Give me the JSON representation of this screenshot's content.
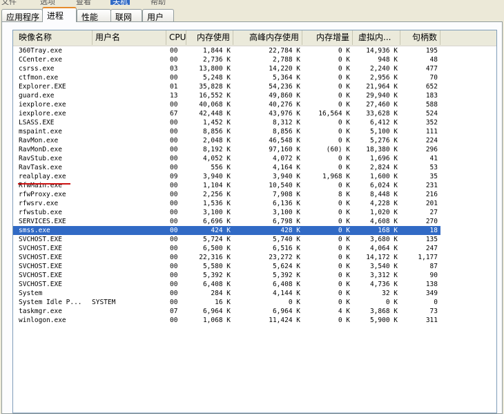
{
  "menubar": {
    "items": [
      "文件",
      "选项",
      "查看",
      "关机",
      "帮助"
    ],
    "active_index": 3
  },
  "tabs": [
    "应用程序",
    "进程",
    "性能",
    "联网",
    "用户"
  ],
  "selected_tab_index": 1,
  "columns": [
    "映像名称",
    "用户名",
    "CPU",
    "内存使用",
    "高峰内存使用",
    "内存增量",
    "虚拟内...",
    "句柄数"
  ],
  "selected_row_index": 20,
  "rows": [
    [
      "360Tray.exe",
      "",
      "00",
      "1,844 K",
      "22,784 K",
      "0 K",
      "14,936 K",
      "195"
    ],
    [
      "CCenter.exe",
      "",
      "00",
      "2,736 K",
      "2,788 K",
      "0 K",
      "948 K",
      "48"
    ],
    [
      "csrss.exe",
      "",
      "03",
      "13,800 K",
      "14,220 K",
      "0 K",
      "2,240 K",
      "477"
    ],
    [
      "ctfmon.exe",
      "",
      "00",
      "5,248 K",
      "5,364 K",
      "0 K",
      "2,956 K",
      "70"
    ],
    [
      "Explorer.EXE",
      "",
      "01",
      "35,828 K",
      "54,236 K",
      "0 K",
      "21,964 K",
      "652"
    ],
    [
      "guard.exe",
      "",
      "13",
      "16,552 K",
      "49,860 K",
      "0 K",
      "29,940 K",
      "183"
    ],
    [
      "iexplore.exe",
      "",
      "00",
      "40,068 K",
      "40,276 K",
      "0 K",
      "27,460 K",
      "588"
    ],
    [
      "iexplore.exe",
      "",
      "67",
      "42,448 K",
      "43,976 K",
      "16,564 K",
      "33,628 K",
      "524"
    ],
    [
      "LSASS.EXE",
      "",
      "00",
      "1,452 K",
      "8,312 K",
      "0 K",
      "6,412 K",
      "352"
    ],
    [
      "mspaint.exe",
      "",
      "00",
      "8,856 K",
      "8,856 K",
      "0 K",
      "5,100 K",
      "111"
    ],
    [
      "RavMon.exe",
      "",
      "00",
      "2,048 K",
      "46,548 K",
      "0 K",
      "5,276 K",
      "224"
    ],
    [
      "RavMonD.exe",
      "",
      "00",
      "8,192 K",
      "97,160 K",
      "(60) K",
      "18,380 K",
      "296"
    ],
    [
      "RavStub.exe",
      "",
      "00",
      "4,052 K",
      "4,072 K",
      "0 K",
      "1,696 K",
      "41"
    ],
    [
      "RavTask.exe",
      "",
      "00",
      "556 K",
      "4,164 K",
      "0 K",
      "2,824 K",
      "53"
    ],
    [
      "realplay.exe",
      "",
      "09",
      "3,940 K",
      "3,940 K",
      "1,968 K",
      "1,600 K",
      "35"
    ],
    [
      "RfwMain.exe",
      "",
      "00",
      "1,104 K",
      "10,540 K",
      "0 K",
      "6,024 K",
      "231"
    ],
    [
      "rfwProxy.exe",
      "",
      "00",
      "2,256 K",
      "7,908 K",
      "8 K",
      "8,448 K",
      "216"
    ],
    [
      "rfwsrv.exe",
      "",
      "00",
      "1,536 K",
      "6,136 K",
      "0 K",
      "4,228 K",
      "201"
    ],
    [
      "rfwstub.exe",
      "",
      "00",
      "3,100 K",
      "3,100 K",
      "0 K",
      "1,020 K",
      "27"
    ],
    [
      "SERVICES.EXE",
      "",
      "00",
      "6,696 K",
      "6,798 K",
      "0 K",
      "4,608 K",
      "270"
    ],
    [
      "smss.exe",
      "",
      "00",
      "424 K",
      "428 K",
      "0 K",
      "168 K",
      "18"
    ],
    [
      "SVCHOST.EXE",
      "",
      "00",
      "5,724 K",
      "5,740 K",
      "0 K",
      "3,680 K",
      "135"
    ],
    [
      "SVCHOST.EXE",
      "",
      "00",
      "6,500 K",
      "6,516 K",
      "0 K",
      "4,064 K",
      "247"
    ],
    [
      "SVCHOST.EXE",
      "",
      "00",
      "22,316 K",
      "23,272 K",
      "0 K",
      "14,172 K",
      "1,177"
    ],
    [
      "SVCHOST.EXE",
      "",
      "00",
      "5,580 K",
      "5,624 K",
      "0 K",
      "3,540 K",
      "87"
    ],
    [
      "SVCHOST.EXE",
      "",
      "00",
      "5,392 K",
      "5,392 K",
      "0 K",
      "3,312 K",
      "90"
    ],
    [
      "SVCHOST.EXE",
      "",
      "00",
      "6,408 K",
      "6,408 K",
      "0 K",
      "4,736 K",
      "138"
    ],
    [
      "System",
      "",
      "00",
      "284 K",
      "4,144 K",
      "0 K",
      "32 K",
      "349"
    ],
    [
      "System Idle P...",
      "SYSTEM",
      "00",
      "16 K",
      "0 K",
      "0 K",
      "0 K",
      "0"
    ],
    [
      "taskmgr.exe",
      "",
      "07",
      "6,964 K",
      "6,964 K",
      "4 K",
      "3,868 K",
      "73"
    ],
    [
      "winlogon.exe",
      "",
      "00",
      "1,068 K",
      "11,424 K",
      "0 K",
      "5,900 K",
      "311"
    ]
  ],
  "highlight": {
    "row_index": 14,
    "color": "#cc1010",
    "selection_color": "#316ac5"
  }
}
